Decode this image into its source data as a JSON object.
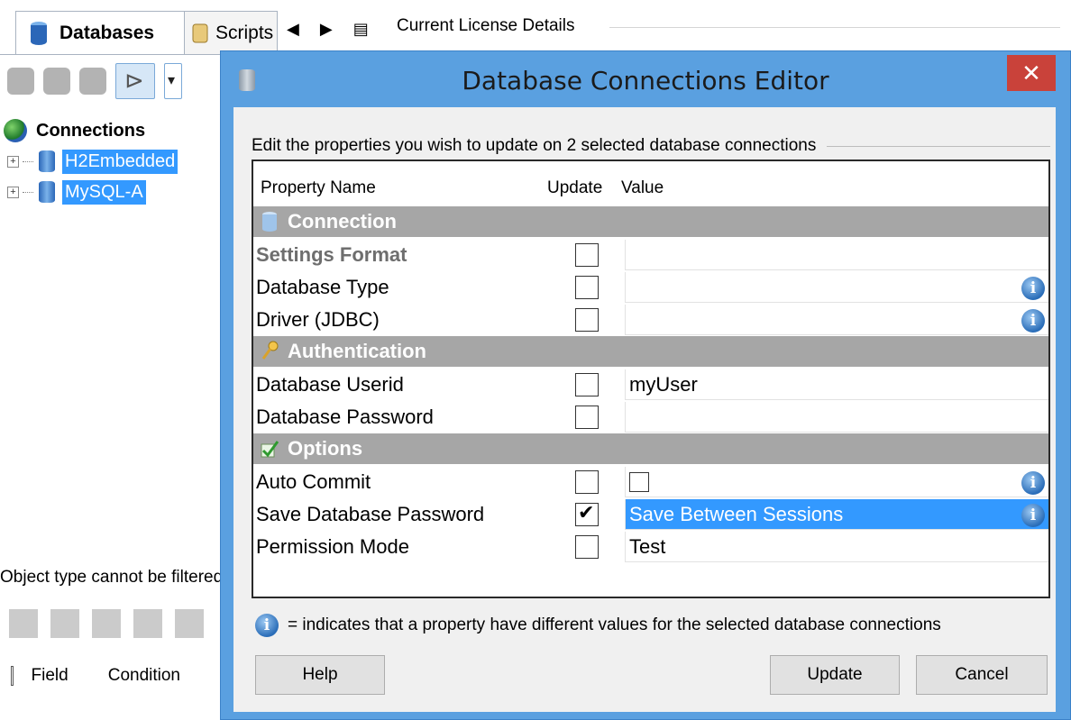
{
  "tabs": {
    "databases": "Databases",
    "scripts": "Scripts",
    "nav": "◀ ▶ ▤"
  },
  "license": {
    "title": "Current License Details"
  },
  "tree": {
    "root": "Connections",
    "items": [
      "H2Embedded",
      "MySQL-A"
    ]
  },
  "filter": {
    "message": "Object type cannot be filtered",
    "columns": [
      "Field",
      "Condition"
    ]
  },
  "dialog": {
    "title": "Database Connections Editor",
    "close": "✕",
    "caption": "Edit the properties you wish to update on 2 selected database connections",
    "columns": {
      "name": "Property Name",
      "update": "Update",
      "value": "Value"
    },
    "categories": {
      "connection": "Connection",
      "authentication": "Authentication",
      "options": "Options"
    },
    "properties": {
      "settings_format": {
        "name": "Settings Format",
        "value": ""
      },
      "database_type": {
        "name": "Database Type",
        "value": ""
      },
      "driver": {
        "name": "Driver (JDBC)",
        "value": ""
      },
      "userid": {
        "name": "Database Userid",
        "value": "myUser"
      },
      "password": {
        "name": "Database Password",
        "value": ""
      },
      "auto_commit": {
        "name": "Auto Commit",
        "value": ""
      },
      "save_password": {
        "name": "Save Database Password",
        "value": "Save Between Sessions",
        "update_checked": true
      },
      "permission_mode": {
        "name": "Permission Mode",
        "value": "Test"
      }
    },
    "info_glyph": "i",
    "legend": "= indicates that a property have different values for the selected database connections",
    "buttons": {
      "help": "Help",
      "update": "Update",
      "cancel": "Cancel"
    }
  },
  "colors": {
    "dialog_frame": "#5aa0e0",
    "close_button": "#c9423a",
    "selection": "#3399ff",
    "category_band": "#a6a6a6"
  }
}
